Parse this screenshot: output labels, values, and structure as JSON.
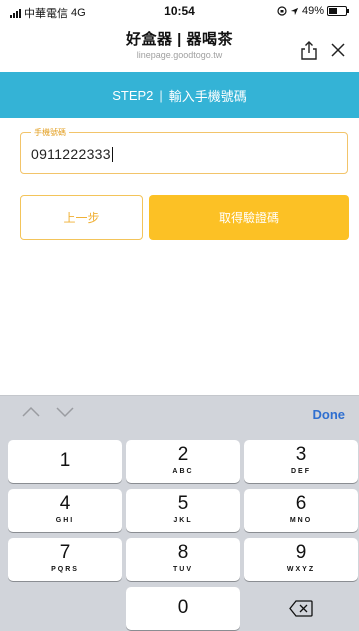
{
  "status_bar": {
    "carrier": "中華電信",
    "network": "4G",
    "time": "10:54",
    "battery": "49%"
  },
  "nav": {
    "title": "好盒器 | 器喝茶",
    "url": "linepage.goodtogo.tw"
  },
  "step": {
    "label": "STEP2",
    "text": "輸入手機號碼"
  },
  "form": {
    "phone_label": "手機號碼",
    "phone_value": "0911222333"
  },
  "buttons": {
    "back": "上一步",
    "get_code": "取得驗證碼"
  },
  "keyboard": {
    "done": "Done",
    "keys": [
      {
        "num": "1",
        "letters": ""
      },
      {
        "num": "2",
        "letters": "ABC"
      },
      {
        "num": "3",
        "letters": "DEF"
      },
      {
        "num": "4",
        "letters": "GHI"
      },
      {
        "num": "5",
        "letters": "JKL"
      },
      {
        "num": "6",
        "letters": "MNO"
      },
      {
        "num": "7",
        "letters": "PQRS"
      },
      {
        "num": "8",
        "letters": "TUV"
      },
      {
        "num": "9",
        "letters": "WXYZ"
      },
      {
        "num": "0",
        "letters": ""
      }
    ]
  },
  "colors": {
    "banner": "#34b3d6",
    "accent": "#fcc125",
    "done": "#2f6fd0"
  }
}
